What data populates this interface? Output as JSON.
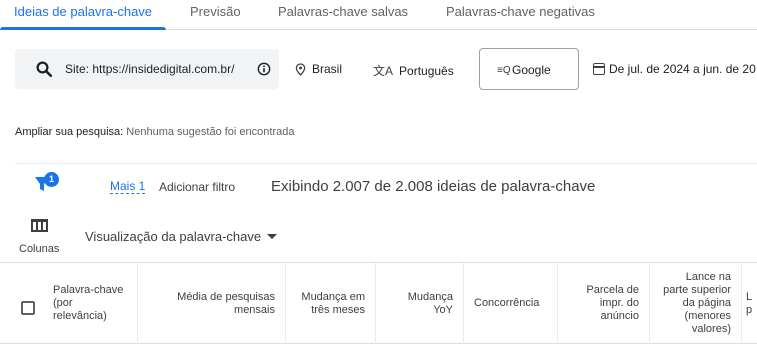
{
  "tabs": [
    {
      "label": "Ideias de palavra-chave",
      "active": true
    },
    {
      "label": "Previsão",
      "active": false
    },
    {
      "label": "Palavras-chave salvas",
      "active": false
    },
    {
      "label": "Palavras-chave negativas",
      "active": false
    }
  ],
  "filters": {
    "site": "Site: https://insidedigital.com.br/",
    "location": "Brasil",
    "language": "Português",
    "network": "Google",
    "date_range": "De jul. de 2024 a jun. de 20"
  },
  "broaden": {
    "label": "Ampliar sua pesquisa:",
    "value": "Nenhuma sugestão foi encontrada"
  },
  "filter_row": {
    "badge_count": "1",
    "more_link": "Mais 1",
    "add_filter": "Adicionar filtro",
    "showing": "Exibindo 2.007 de 2.008 ideias de palavra-chave"
  },
  "columns_label": "Colunas",
  "view_select": "Visualização da palavra-chave",
  "table": {
    "headers": [
      "Palavra-chave (por relevância)",
      "Média de pesquisas mensais",
      "Mudança em três meses",
      "Mudança YoY",
      "Concorrência",
      "Parcela de impr. do anúncio",
      "Lance na parte superior da página (menores valores)",
      "L p"
    ]
  },
  "colors": {
    "accent": "#1a73e8",
    "text": "#3c4043",
    "muted": "#5f6368"
  }
}
